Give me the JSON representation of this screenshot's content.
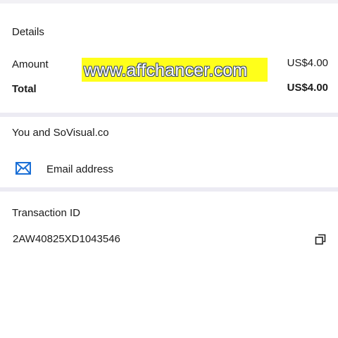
{
  "details": {
    "heading": "Details",
    "amount_label": "Amount",
    "amount_value": "US$4.00",
    "total_label": "Total",
    "total_value": "US$4.00"
  },
  "watermark": {
    "text": "www.affchancer.com",
    "background_color": "#ffff1a"
  },
  "contact": {
    "heading": "You and SoVisual.co",
    "email_label": "Email address",
    "email_icon": "envelope-icon",
    "icon_color": "#1a6fd6"
  },
  "transaction": {
    "heading": "Transaction ID",
    "id_value": "2AW40825XD1043546",
    "copy_icon": "copy-icon"
  }
}
